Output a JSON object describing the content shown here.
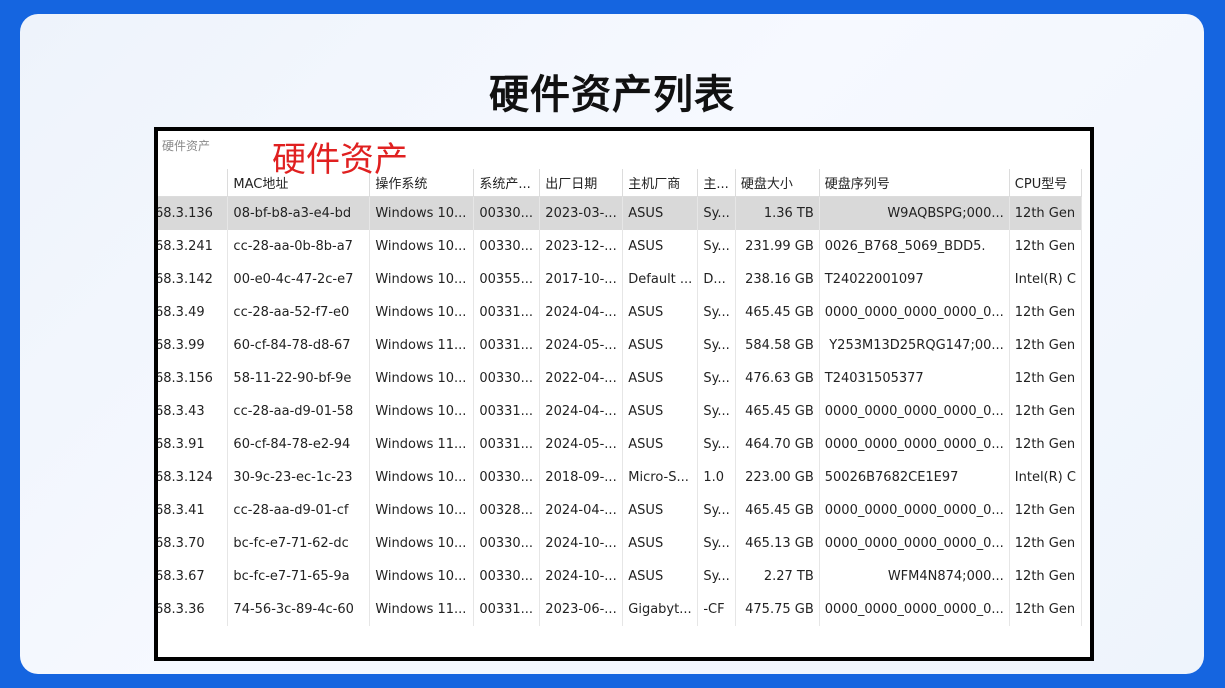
{
  "page": {
    "title": "硬件资产列表"
  },
  "window": {
    "caption": "硬件资产"
  },
  "overlay": {
    "label": "硬件资产"
  },
  "table": {
    "columns": [
      "",
      "MAC地址",
      "操作系统",
      "系统产...",
      "出厂日期",
      "主机厂商",
      "主...",
      "硬盘大小",
      "硬盘序列号",
      "CPU型号"
    ],
    "rows": [
      [
        "68.3.136",
        "08-bf-b8-a3-e4-bd",
        "Windows 10...",
        "00330...",
        "2023-03-...",
        "ASUS",
        "Sy...",
        "1.36 TB",
        "W9AQBSPG;000...",
        "12th Gen"
      ],
      [
        "68.3.241",
        "cc-28-aa-0b-8b-a7",
        "Windows 10...",
        "00330...",
        "2023-12-...",
        "ASUS",
        "Sy...",
        "231.99 GB",
        "0026_B768_5069_BDD5.",
        "12th Gen"
      ],
      [
        "68.3.142",
        "00-e0-4c-47-2c-e7",
        "Windows 10...",
        "00355...",
        "2017-10-...",
        "Default ...",
        "D...",
        "238.16 GB",
        "T24022001097",
        "Intel(R) C"
      ],
      [
        "68.3.49",
        "cc-28-aa-52-f7-e0",
        "Windows 10...",
        "00331...",
        "2024-04-...",
        "ASUS",
        "Sy...",
        "465.45 GB",
        "0000_0000_0000_0000_0...",
        "12th Gen"
      ],
      [
        "68.3.99",
        "60-cf-84-78-d8-67",
        "Windows 11...",
        "00331...",
        "2024-05-...",
        "ASUS",
        "Sy...",
        "584.58 GB",
        "Y253M13D25RQG147;00...",
        "12th Gen"
      ],
      [
        "68.3.156",
        "58-11-22-90-bf-9e",
        "Windows 10...",
        "00330...",
        "2022-04-...",
        "ASUS",
        "Sy...",
        "476.63 GB",
        "T24031505377",
        "12th Gen"
      ],
      [
        "68.3.43",
        "cc-28-aa-d9-01-58",
        "Windows 10...",
        "00331...",
        "2024-04-...",
        "ASUS",
        "Sy...",
        "465.45 GB",
        "0000_0000_0000_0000_0...",
        "12th Gen"
      ],
      [
        "68.3.91",
        "60-cf-84-78-e2-94",
        "Windows 11...",
        "00331...",
        "2024-05-...",
        "ASUS",
        "Sy...",
        "464.70 GB",
        "0000_0000_0000_0000_0...",
        "12th Gen"
      ],
      [
        "68.3.124",
        "30-9c-23-ec-1c-23",
        "Windows 10...",
        "00330...",
        "2018-09-...",
        "Micro-S...",
        "1.0",
        "223.00 GB",
        "50026B7682CE1E97",
        "Intel(R) C"
      ],
      [
        "68.3.41",
        "cc-28-aa-d9-01-cf",
        "Windows 10...",
        "00328...",
        "2024-04-...",
        "ASUS",
        "Sy...",
        "465.45 GB",
        "0000_0000_0000_0000_0...",
        "12th Gen"
      ],
      [
        "68.3.70",
        "bc-fc-e7-71-62-dc",
        "Windows 10...",
        "00330...",
        "2024-10-...",
        "ASUS",
        "Sy...",
        "465.13 GB",
        "0000_0000_0000_0000_0...",
        "12th Gen"
      ],
      [
        "68.3.67",
        "bc-fc-e7-71-65-9a",
        "Windows 10...",
        "00330...",
        "2024-10-...",
        "ASUS",
        "Sy...",
        "2.27 TB",
        "WFM4N874;000...",
        "12th Gen"
      ],
      [
        "68.3.36",
        "74-56-3c-89-4c-60",
        "Windows 11...",
        "00331...",
        "2023-06-...",
        "Gigabyt...",
        "-CF",
        "475.75 GB",
        "0000_0000_0000_0000_0...",
        "12th Gen"
      ]
    ]
  }
}
